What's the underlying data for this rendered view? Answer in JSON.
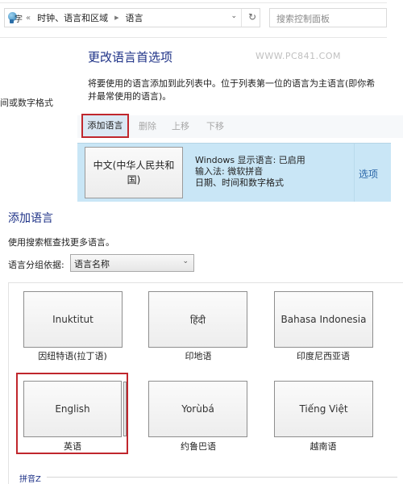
{
  "address_bar": {
    "overflow": "«",
    "crumbs": [
      "时钟、语言和区域",
      "语言"
    ],
    "dropdown_icon": "chevron-down-icon",
    "refresh_icon": "refresh-icon"
  },
  "search": {
    "placeholder": "搜索控制面板"
  },
  "sidebar": {
    "partial_link": "间或数字格式"
  },
  "header": {
    "title": "更改语言首选项",
    "watermark": "WWW.PC841.COM",
    "description_line1": "将要使用的语言添加到此列表中。位于列表第一位的语言为主语言(即你希",
    "description_line2": "并最常使用的语言)。"
  },
  "toolbar": {
    "add": "添加语言",
    "remove": "删除",
    "move_up": "上移",
    "move_down": "下移"
  },
  "installed_language": {
    "name": "中文(中华人民共和国)",
    "info": [
      "Windows 显示语言: 已启用",
      "输入法: 微软拼音",
      "日期、时间和数字格式"
    ],
    "options": "选项"
  },
  "add_language": {
    "title": "添加语言",
    "hint": "使用搜索框查找更多语言。",
    "group_by_label": "语言分组依据:",
    "group_by_value": "语言名称",
    "tiles": [
      {
        "native": "Inuktitut",
        "caption": "因纽特语(拉丁语)"
      },
      {
        "native": "हिंदी",
        "caption": "印地语"
      },
      {
        "native": "Bahasa Indonesia",
        "caption": "印度尼西亚语"
      },
      {
        "native": "English",
        "caption": "英语",
        "highlighted": true
      },
      {
        "native": "Yorùbá",
        "caption": "约鲁巴语"
      },
      {
        "native": "Tiếng Việt",
        "caption": "越南语"
      }
    ],
    "section_label": "拼音Z"
  },
  "colors": {
    "heading": "#1e3287",
    "highlight": "#c0272d",
    "selected_row": "#c9e6f6",
    "link": "#2a66a8"
  }
}
